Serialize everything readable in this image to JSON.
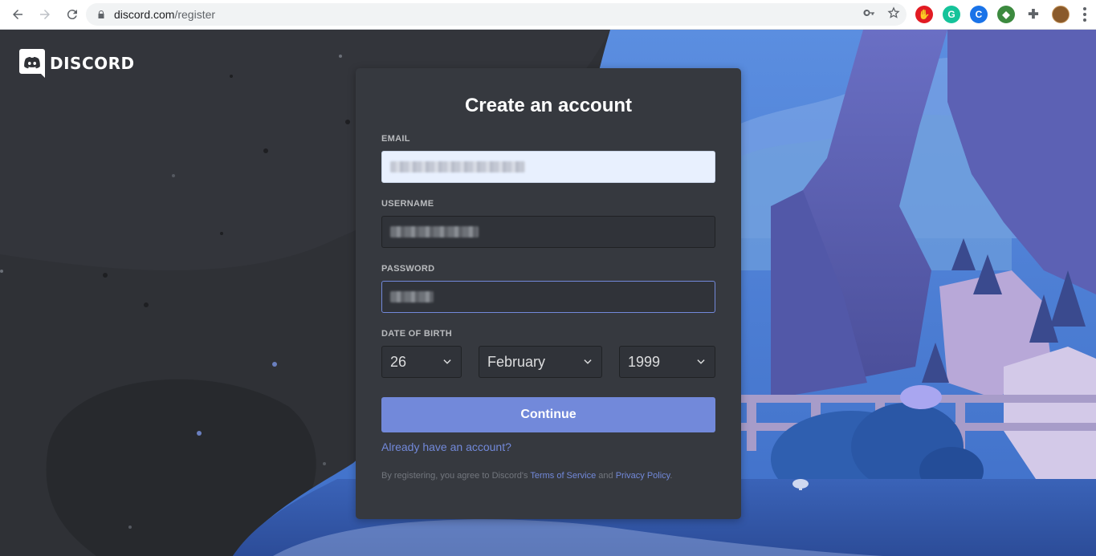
{
  "browser": {
    "url_host": "discord.com",
    "url_path": "/register",
    "extensions": [
      {
        "name": "adblock-icon",
        "color": "#e21b23",
        "glyph": "✋"
      },
      {
        "name": "grammarly-icon",
        "color": "#15c39a",
        "glyph": "G"
      },
      {
        "name": "refresh-ext-icon",
        "color": "#1a73e8",
        "glyph": "C"
      },
      {
        "name": "world-ext-icon",
        "color": "#3c8a3f",
        "glyph": "◆"
      },
      {
        "name": "puzzle-icon",
        "color": "#5f6368",
        "glyph": "✚"
      }
    ]
  },
  "brand": {
    "wordmark": "DISCORD"
  },
  "form": {
    "title": "Create an account",
    "email_label": "EMAIL",
    "username_label": "USERNAME",
    "password_label": "PASSWORD",
    "dob_label": "DATE OF BIRTH",
    "dob_day": "26",
    "dob_month": "February",
    "dob_year": "1999",
    "continue_label": "Continue",
    "login_link": "Already have an account?",
    "terms_prefix": "By registering, you agree to Discord's ",
    "terms_link": "Terms of Service",
    "terms_and": " and ",
    "privacy_link": "Privacy Policy",
    "terms_suffix": "."
  },
  "colors": {
    "accent": "#7289da",
    "card": "#36393f",
    "background": "#2f3136"
  }
}
